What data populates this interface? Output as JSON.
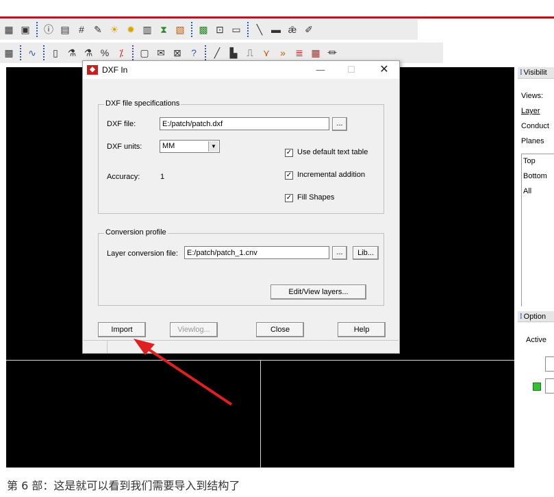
{
  "toolbar1": {
    "icons": [
      "grid-icon",
      "chip-icon",
      "info-icon",
      "component-icon",
      "counter-icon",
      "brush-icon",
      "sun-icon",
      "gear-sun-icon",
      "library-icon",
      "hourglass-icon",
      "stack-icon",
      "board-icon",
      "chip-module-icon",
      "battery-icon",
      "line-tool-icon",
      "rectangle-icon",
      "text-abc-icon",
      "text-edit-icon"
    ]
  },
  "toolbar2": {
    "icons": [
      "grid-icon",
      "wave-icon",
      "sheet-icon",
      "flask-icon",
      "flask2-icon",
      "percent-icon",
      "mouse-icon",
      "envelope-icon",
      "envelope2-icon",
      "help-icon",
      "chart-icon",
      "chart2-icon",
      "route-icon",
      "net-icon",
      "play-icon",
      "layers-icon",
      "table-icon",
      "signal-icon"
    ]
  },
  "right_panel": {
    "visibility_header": "Visibilit",
    "views": "Views:",
    "layer": "Layer",
    "conduct": "Conduct",
    "planes": "Planes",
    "list": [
      "Top",
      "Bottom",
      "All"
    ],
    "options_header": "Option",
    "active": "Active"
  },
  "dialog": {
    "title": "DXF In",
    "specs_group": "DXF file specifications",
    "dxf_file_label": "DXF file:",
    "dxf_file_value": "E:/patch/patch.dxf",
    "browse": "...",
    "units_label": "DXF units:",
    "units_value": "MM",
    "accuracy_label": "Accuracy:",
    "accuracy_value": "1",
    "cb_default_text": "Use default text table",
    "cb_incremental": "Incremental addition",
    "cb_fill": "Fill Shapes",
    "profile_group": "Conversion profile",
    "layer_conv_label": "Layer conversion file:",
    "layer_conv_value": "E:/patch/patch_1.cnv",
    "lib": "Lib...",
    "edit_view": "Edit/View layers...",
    "import": "Import",
    "viewlog": "Viewlog...",
    "close": "Close",
    "help": "Help"
  },
  "caption": "第 6 部：这是就可以看到我们需要导入到结构了",
  "colors": {
    "arrow": "#e02020",
    "accent_line": "#b01818",
    "canvas": "#000000"
  }
}
